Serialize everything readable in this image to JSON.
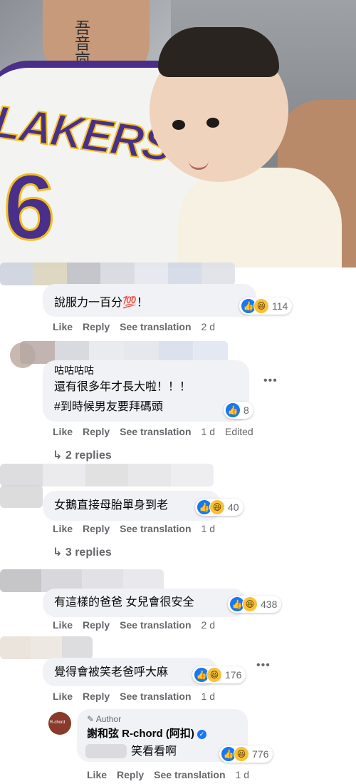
{
  "photo": {
    "tattoo_text": "吾\n音\n㐭"
  },
  "jersey_text": "LAKERS",
  "jersey_number": "6",
  "comments": [
    {
      "text": "說服力一百分💯！",
      "reactions": {
        "like": true,
        "haha": true,
        "count": "114"
      },
      "actions": {
        "like": "Like",
        "reply": "Reply",
        "see_translation": "See translation",
        "time": "2 d",
        "edited": ""
      }
    },
    {
      "lines": [
        "咕咕咕咕",
        "還有很多年才長大啦！！！",
        "#到時候男友要拜碼頭"
      ],
      "reactions": {
        "like": true,
        "haha": false,
        "count": "8"
      },
      "actions": {
        "like": "Like",
        "reply": "Reply",
        "see_translation": "See translation",
        "time": "1 d",
        "edited": "Edited"
      },
      "replies_label": "2 replies",
      "more": "•••"
    },
    {
      "text": "女鵝直接母胎單身到老",
      "reactions": {
        "like": true,
        "haha": true,
        "count": "40"
      },
      "actions": {
        "like": "Like",
        "reply": "Reply",
        "see_translation": "See translation",
        "time": "1 d"
      },
      "replies_label": "3 replies"
    },
    {
      "text": "有這樣的爸爸 女兒會很安全",
      "reactions": {
        "like": true,
        "haha": true,
        "count": "438"
      },
      "actions": {
        "like": "Like",
        "reply": "Reply",
        "see_translation": "See translation",
        "time": "2 d"
      }
    },
    {
      "text": "覺得會被笑老爸呼大麻",
      "reactions": {
        "like": true,
        "haha": true,
        "count": "176"
      },
      "actions": {
        "like": "Like",
        "reply": "Reply",
        "see_translation": "See translation",
        "time": "1 d"
      },
      "more": "•••"
    }
  ],
  "author_reply": {
    "badge": "Author",
    "name": "謝和弦 R-chord (阿扣)",
    "text": "笑看看啊",
    "avatar_label": "R-chord",
    "reactions": {
      "like": true,
      "haha": true,
      "count": "776"
    },
    "actions": {
      "like": "Like",
      "reply": "Reply",
      "see_translation": "See translation",
      "time": "1 d"
    }
  },
  "colors": {
    "accent": "#1877f2",
    "bubble": "#f0f2f5",
    "muted": "#65676b",
    "haha": "#f7c23a"
  }
}
